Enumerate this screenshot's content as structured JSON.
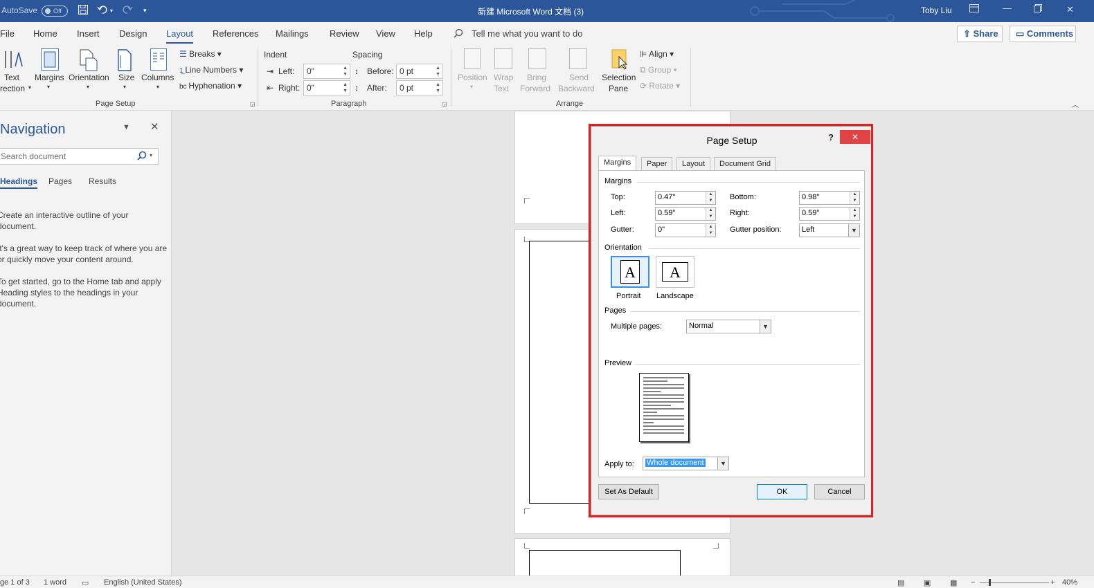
{
  "titlebar": {
    "autosave_label": "AutoSave",
    "autosave_toggle": "Off",
    "doc_title": "新建 Microsoft Word 文档 (3)",
    "user": "Toby Liu",
    "icons": [
      "save-icon",
      "undo-icon",
      "redo-icon",
      "customize-icon",
      "ribbon-display-icon",
      "minimize-icon",
      "restore-icon",
      "close-icon"
    ]
  },
  "menubar": {
    "items": [
      "File",
      "Home",
      "Insert",
      "Design",
      "Layout",
      "References",
      "Mailings",
      "Review",
      "View",
      "Help"
    ],
    "active": "Layout",
    "tell_me": "Tell me what you want to do",
    "share": "Share",
    "comments": "Comments"
  },
  "ribbon": {
    "page_setup": {
      "text_direction_1": "Text",
      "text_direction_2": "rection",
      "margins": "Margins",
      "orientation": "Orientation",
      "size": "Size",
      "columns": "Columns",
      "breaks": "Breaks",
      "line_numbers": "Line Numbers",
      "hyphenation": "Hyphenation",
      "group": "Page Setup"
    },
    "paragraph": {
      "indent": "Indent",
      "spacing": "Spacing",
      "left_label": "Left:",
      "left_value": "0\"",
      "right_label": "Right:",
      "right_value": "0\"",
      "before_label": "Before:",
      "before_value": "0 pt",
      "after_label": "After:",
      "after_value": "0 pt",
      "group": "Paragraph"
    },
    "arrange": {
      "position": "Position",
      "wrap_1": "Wrap",
      "wrap_2": "Text",
      "bring_1": "Bring",
      "bring_2": "Forward",
      "send_1": "Send",
      "send_2": "Backward",
      "selection_1": "Selection",
      "selection_2": "Pane",
      "align": "Align",
      "group_btn": "Group",
      "rotate": "Rotate",
      "group": "Arrange"
    }
  },
  "navigation": {
    "title": "Navigation",
    "search_placeholder": "Search document",
    "tabs": [
      "Headings",
      "Pages",
      "Results"
    ],
    "active_tab": "Headings",
    "text_1a": "Create an interactive outline of your",
    "text_1b": "document.",
    "text_2a": "It's a great way to keep track of where you are",
    "text_2b": "or quickly move your content around.",
    "text_3a": "To get started, go to the Home tab and apply",
    "text_3b": "Heading styles to the headings in your",
    "text_3c": "document."
  },
  "dialog": {
    "title": "Page Setup",
    "help": "?",
    "tabs": [
      "Margins",
      "Paper",
      "Layout",
      "Document Grid"
    ],
    "active_tab": "Margins",
    "margins_section": "Margins",
    "top_label": "Top:",
    "top_value": "0.47\"",
    "bottom_label": "Bottom:",
    "bottom_value": "0.98\"",
    "left_label": "Left:",
    "left_value": "0.59\"",
    "right_label": "Right:",
    "right_value": "0.59\"",
    "gutter_label": "Gutter:",
    "gutter_value": "0\"",
    "gutter_pos_label": "Gutter position:",
    "gutter_pos_value": "Left",
    "orientation_section": "Orientation",
    "portrait": "Portrait",
    "landscape": "Landscape",
    "orientation_selected": "Portrait",
    "pages_section": "Pages",
    "multiple_pages_label": "Multiple pages:",
    "multiple_pages_value": "Normal",
    "preview_section": "Preview",
    "apply_to_label": "Apply to:",
    "apply_to_value": "Whole document",
    "set_default": "Set As Default",
    "ok": "OK",
    "cancel": "Cancel"
  },
  "statusbar": {
    "page": "ge 1 of 3",
    "words": "1 word",
    "language": "English (United States)",
    "zoom": "40%"
  },
  "colors": {
    "accent": "#2b579a",
    "highlight_box": "#e02020",
    "dialog_close": "#e04343"
  }
}
